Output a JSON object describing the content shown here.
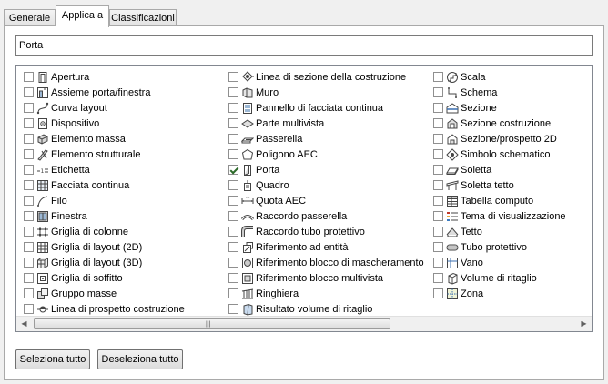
{
  "tabs": [
    {
      "label": "Generale"
    },
    {
      "label": "Applica a"
    },
    {
      "label": "Classificazioni"
    }
  ],
  "name_field": {
    "value": "Porta"
  },
  "columns": [
    [
      {
        "label": "Apertura",
        "checked": false,
        "icon": "opening-icon"
      },
      {
        "label": "Assieme porta/finestra",
        "checked": false,
        "icon": "door-window-assembly-icon"
      },
      {
        "label": "Curva layout",
        "checked": false,
        "icon": "layout-curve-icon"
      },
      {
        "label": "Dispositivo",
        "checked": false,
        "icon": "device-icon"
      },
      {
        "label": "Elemento massa",
        "checked": false,
        "icon": "mass-element-icon"
      },
      {
        "label": "Elemento strutturale",
        "checked": false,
        "icon": "structural-member-icon"
      },
      {
        "label": "Etichetta",
        "checked": false,
        "icon": "label-icon"
      },
      {
        "label": "Facciata continua",
        "checked": false,
        "icon": "curtain-wall-icon"
      },
      {
        "label": "Filo",
        "checked": false,
        "icon": "wire-icon"
      },
      {
        "label": "Finestra",
        "checked": false,
        "icon": "window-icon"
      },
      {
        "label": "Griglia di colonne",
        "checked": false,
        "icon": "column-grid-icon"
      },
      {
        "label": "Griglia di layout (2D)",
        "checked": false,
        "icon": "layout-grid-2d-icon"
      },
      {
        "label": "Griglia di layout (3D)",
        "checked": false,
        "icon": "layout-grid-3d-icon"
      },
      {
        "label": "Griglia di soffitto",
        "checked": false,
        "icon": "ceiling-grid-icon"
      },
      {
        "label": "Gruppo masse",
        "checked": false,
        "icon": "mass-group-icon"
      },
      {
        "label": "Linea di prospetto costruzione",
        "checked": false,
        "icon": "elevation-line-icon"
      }
    ],
    [
      {
        "label": "Linea di sezione della costruzione",
        "checked": false,
        "icon": "section-line-icon"
      },
      {
        "label": "Muro",
        "checked": false,
        "icon": "wall-icon"
      },
      {
        "label": "Pannello di facciata continua",
        "checked": false,
        "icon": "curtain-wall-panel-icon"
      },
      {
        "label": "Parte multivista",
        "checked": false,
        "icon": "multiview-part-icon"
      },
      {
        "label": "Passerella",
        "checked": false,
        "icon": "cable-tray-icon"
      },
      {
        "label": "Poligono AEC",
        "checked": false,
        "icon": "aec-polygon-icon"
      },
      {
        "label": "Porta",
        "checked": true,
        "icon": "door-icon"
      },
      {
        "label": "Quadro",
        "checked": false,
        "icon": "panel-icon"
      },
      {
        "label": "Quota AEC",
        "checked": false,
        "icon": "aec-dimension-icon"
      },
      {
        "label": "Raccordo passerella",
        "checked": false,
        "icon": "cable-tray-fitting-icon"
      },
      {
        "label": "Raccordo tubo protettivo",
        "checked": false,
        "icon": "conduit-fitting-icon"
      },
      {
        "label": "Riferimento ad entità",
        "checked": false,
        "icon": "entity-reference-icon"
      },
      {
        "label": "Riferimento blocco di mascheramento",
        "checked": false,
        "icon": "mask-block-reference-icon"
      },
      {
        "label": "Riferimento blocco multivista",
        "checked": false,
        "icon": "multiview-block-reference-icon"
      },
      {
        "label": "Ringhiera",
        "checked": false,
        "icon": "railing-icon"
      },
      {
        "label": "Risultato volume di ritaglio",
        "checked": false,
        "icon": "clip-volume-result-icon"
      }
    ],
    [
      {
        "label": "Scala",
        "checked": false,
        "icon": "stair-icon"
      },
      {
        "label": "Schema",
        "checked": false,
        "icon": "schematic-icon"
      },
      {
        "label": "Sezione",
        "checked": false,
        "icon": "section-icon"
      },
      {
        "label": "Sezione costruzione",
        "checked": false,
        "icon": "building-section-icon"
      },
      {
        "label": "Sezione/prospetto 2D",
        "checked": false,
        "icon": "section-elevation-2d-icon"
      },
      {
        "label": "Simbolo schematico",
        "checked": false,
        "icon": "schematic-symbol-icon"
      },
      {
        "label": "Soletta",
        "checked": false,
        "icon": "slab-icon"
      },
      {
        "label": "Soletta tetto",
        "checked": false,
        "icon": "roof-slab-icon"
      },
      {
        "label": "Tabella computo",
        "checked": false,
        "icon": "schedule-table-icon"
      },
      {
        "label": "Tema di visualizzazione",
        "checked": false,
        "icon": "display-theme-icon"
      },
      {
        "label": "Tetto",
        "checked": false,
        "icon": "roof-icon"
      },
      {
        "label": "Tubo protettivo",
        "checked": false,
        "icon": "conduit-icon"
      },
      {
        "label": "Vano",
        "checked": false,
        "icon": "space-icon"
      },
      {
        "label": "Volume di ritaglio",
        "checked": false,
        "icon": "clip-volume-icon"
      },
      {
        "label": "Zona",
        "checked": false,
        "icon": "zone-icon"
      }
    ]
  ],
  "buttons": {
    "select_all": "Seleziona tutto",
    "deselect_all": "Deseleziona tutto"
  }
}
